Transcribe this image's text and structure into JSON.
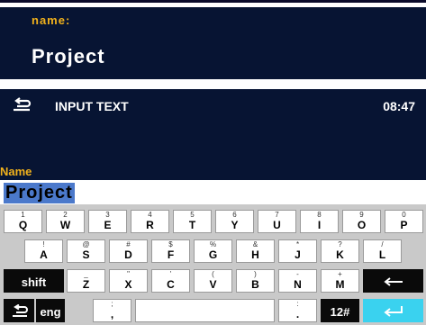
{
  "preview": {
    "label": "name:",
    "value": "Project"
  },
  "header": {
    "title": "INPUT TEXT",
    "time": "08:47"
  },
  "field": {
    "label": "Name",
    "value": "Project"
  },
  "keyboard": {
    "row1": [
      {
        "sub": "1",
        "main": "Q"
      },
      {
        "sub": "2",
        "main": "W"
      },
      {
        "sub": "3",
        "main": "E"
      },
      {
        "sub": "4",
        "main": "R"
      },
      {
        "sub": "5",
        "main": "T"
      },
      {
        "sub": "6",
        "main": "Y"
      },
      {
        "sub": "7",
        "main": "U"
      },
      {
        "sub": "8",
        "main": "I"
      },
      {
        "sub": "9",
        "main": "O"
      },
      {
        "sub": "0",
        "main": "P"
      }
    ],
    "row2": [
      {
        "sub": "!",
        "main": "A"
      },
      {
        "sub": "@",
        "main": "S"
      },
      {
        "sub": "#",
        "main": "D"
      },
      {
        "sub": "$",
        "main": "F"
      },
      {
        "sub": "%",
        "main": "G"
      },
      {
        "sub": "&",
        "main": "H"
      },
      {
        "sub": "*",
        "main": "J"
      },
      {
        "sub": "?",
        "main": "K"
      },
      {
        "sub": "/",
        "main": "L"
      }
    ],
    "row3": [
      {
        "sub": "_",
        "main": "Z"
      },
      {
        "sub": "\"",
        "main": "X"
      },
      {
        "sub": "'",
        "main": "C"
      },
      {
        "sub": "(",
        "main": "V"
      },
      {
        "sub": ")",
        "main": "B"
      },
      {
        "sub": "-",
        "main": "N"
      },
      {
        "sub": "+",
        "main": "M"
      }
    ],
    "shift_label": "shift",
    "lang_label": "eng",
    "semicolon": {
      "sub": ";",
      "main": ","
    },
    "colon": {
      "sub": ":",
      "main": "."
    },
    "numsym_label": "12#"
  },
  "colors": {
    "header_bg": "#071433",
    "accent_label": "#f2b21c",
    "selection": "#4b79cb",
    "enter_key": "#3ad2ef"
  },
  "icons": {
    "back": "back-arrow-icon",
    "backspace": "backspace-arrow-icon",
    "enter": "enter-icon"
  }
}
